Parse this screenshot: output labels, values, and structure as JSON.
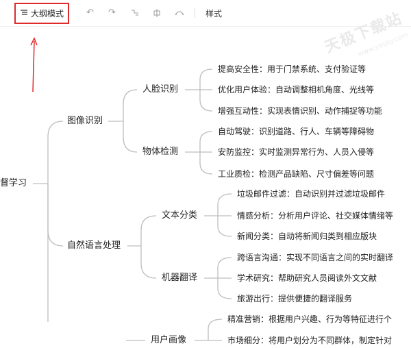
{
  "toolbar": {
    "outline_mode_label": "大纲模式",
    "style_label": "样式",
    "icons": [
      "list-icon",
      "undo-icon",
      "redo-icon",
      "subtopic-icon",
      "sibling-topic-icon",
      "summary-icon"
    ]
  },
  "watermark": {
    "main": "天极下载站",
    "sub": "www.yesky.com"
  },
  "mindmap": {
    "root": "督学习",
    "branches": [
      {
        "label": "图像识别",
        "children": [
          {
            "label": "人脸识别",
            "leaves": [
              "提高安全性：用于门禁系统、支付验证等",
              "优化用户体验：自动调整相机角度、光线等",
              "增强互动性：实现表情识别、动作捕捉等功能"
            ]
          },
          {
            "label": "物体检测",
            "leaves": [
              "自动驾驶：识别道路、行人、车辆等障碍物",
              "安防监控：实时监测异常行为、人员入侵等",
              "工业质检：检测产品缺陷、尺寸偏差等问题"
            ]
          }
        ]
      },
      {
        "label": "自然语言处理",
        "children": [
          {
            "label": "文本分类",
            "leaves": [
              "垃圾邮件过滤：自动识别并过滤垃圾邮件",
              "情感分析：分析用户评论、社交媒体情绪等",
              "新闻分类：自动将新闻归类到相应版块"
            ]
          },
          {
            "label": "机器翻译",
            "leaves": [
              "跨语言沟通：实现不同语言之间的实时翻译",
              "学术研究：帮助研究人员阅读外文文献",
              "旅游出行：提供便捷的翻译服务"
            ]
          }
        ]
      },
      {
        "label": "",
        "children": [
          {
            "label": "用户画像",
            "leaves": [
              "精准营销：根据用户兴趣、行为等特征进行个",
              "市场细分：将用户划分为不同群体，制定针对"
            ]
          }
        ]
      }
    ]
  }
}
